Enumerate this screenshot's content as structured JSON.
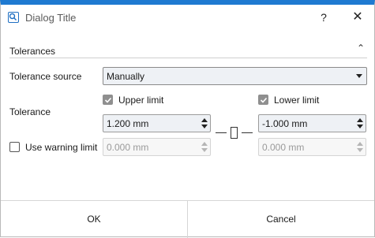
{
  "window": {
    "title": "Dialog Title",
    "help_label": "?",
    "close_label": "✕"
  },
  "section": {
    "title": "Tolerances",
    "collapse_glyph": "⌃"
  },
  "tolerance_source": {
    "label": "Tolerance source",
    "selected": "Manually"
  },
  "tolerance": {
    "label": "Tolerance",
    "upper": {
      "label": "Upper limit",
      "checked": true,
      "value": "1.200 mm"
    },
    "lower": {
      "label": "Lower limit",
      "checked": true,
      "value": "-1.000 mm"
    }
  },
  "warning": {
    "label": "Use warning limit",
    "checked": false,
    "upper_value": "0.000 mm",
    "lower_value": "0.000 mm"
  },
  "buttons": {
    "ok": "OK",
    "cancel": "Cancel"
  },
  "colors": {
    "accent": "#1f7ad1",
    "checkbox_checked": "#8f8f8f"
  }
}
